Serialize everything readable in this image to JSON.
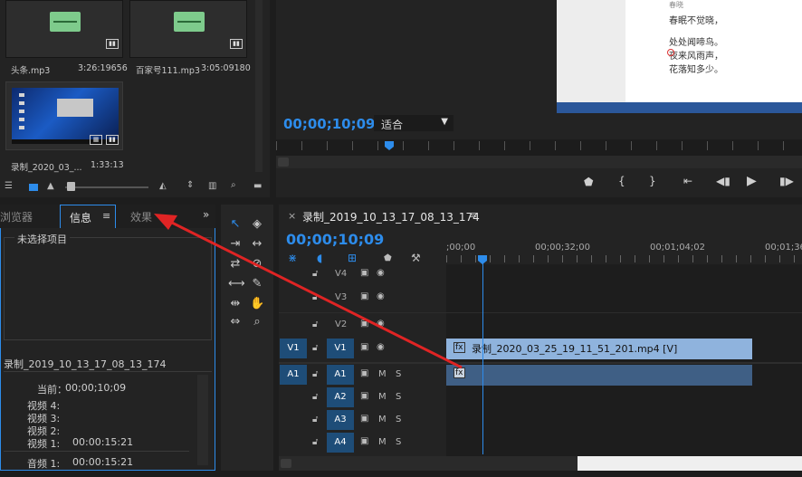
{
  "project": {
    "items": [
      {
        "name": "头条.mp3",
        "duration": "3:26:19656"
      },
      {
        "name": "百家号111.mp3",
        "duration": "3:05:09180"
      },
      {
        "name": "录制_2020_03_...",
        "duration": "1:33:13"
      }
    ]
  },
  "program": {
    "timecode": "00;00;10;09",
    "fit_label": "适合",
    "document_lines": [
      "春眠不觉晓，",
      "处处闻啼鸟。",
      "夜来风雨声，",
      "花落知多少。"
    ],
    "document_partial": "春晓"
  },
  "info_panel": {
    "tabs": [
      "浏览器",
      "信息",
      "效果"
    ],
    "no_selection": "未选择项目",
    "sequence_name": "录制_2019_10_13_17_08_13_174",
    "current_label": "当前：",
    "current_value": "00;00;10;09",
    "rows": [
      {
        "label": "视频 4:",
        "value": ""
      },
      {
        "label": "视频 3:",
        "value": ""
      },
      {
        "label": "视频 2:",
        "value": ""
      },
      {
        "label": "视频 1:",
        "value": "00:00:15:21"
      },
      {
        "label": "音频 1:",
        "value": "00:00:15:21"
      }
    ]
  },
  "timeline": {
    "sequence_name": "录制_2019_10_13_17_08_13_174",
    "timecode": "00;00;10;09",
    "ruler": [
      ";00;00",
      "00;00;32;00",
      "00;01;04;02",
      "00;01;36"
    ],
    "video_tracks": [
      "V4",
      "V3",
      "V2",
      "V1"
    ],
    "audio_tracks": [
      "A1",
      "A2",
      "A3",
      "A4"
    ],
    "source_v": "V1",
    "source_a": "A1",
    "m_label": "M",
    "s_label": "S",
    "clip_name": "录制_2020_03_25_19_11_51_201.mp4 [V]",
    "fx_label": "fx"
  },
  "colors": {
    "accent": "#2d8ceb",
    "arrow": "#e02424",
    "video_clip": "#8fb3dd",
    "audio_clip": "#3f5f85"
  }
}
